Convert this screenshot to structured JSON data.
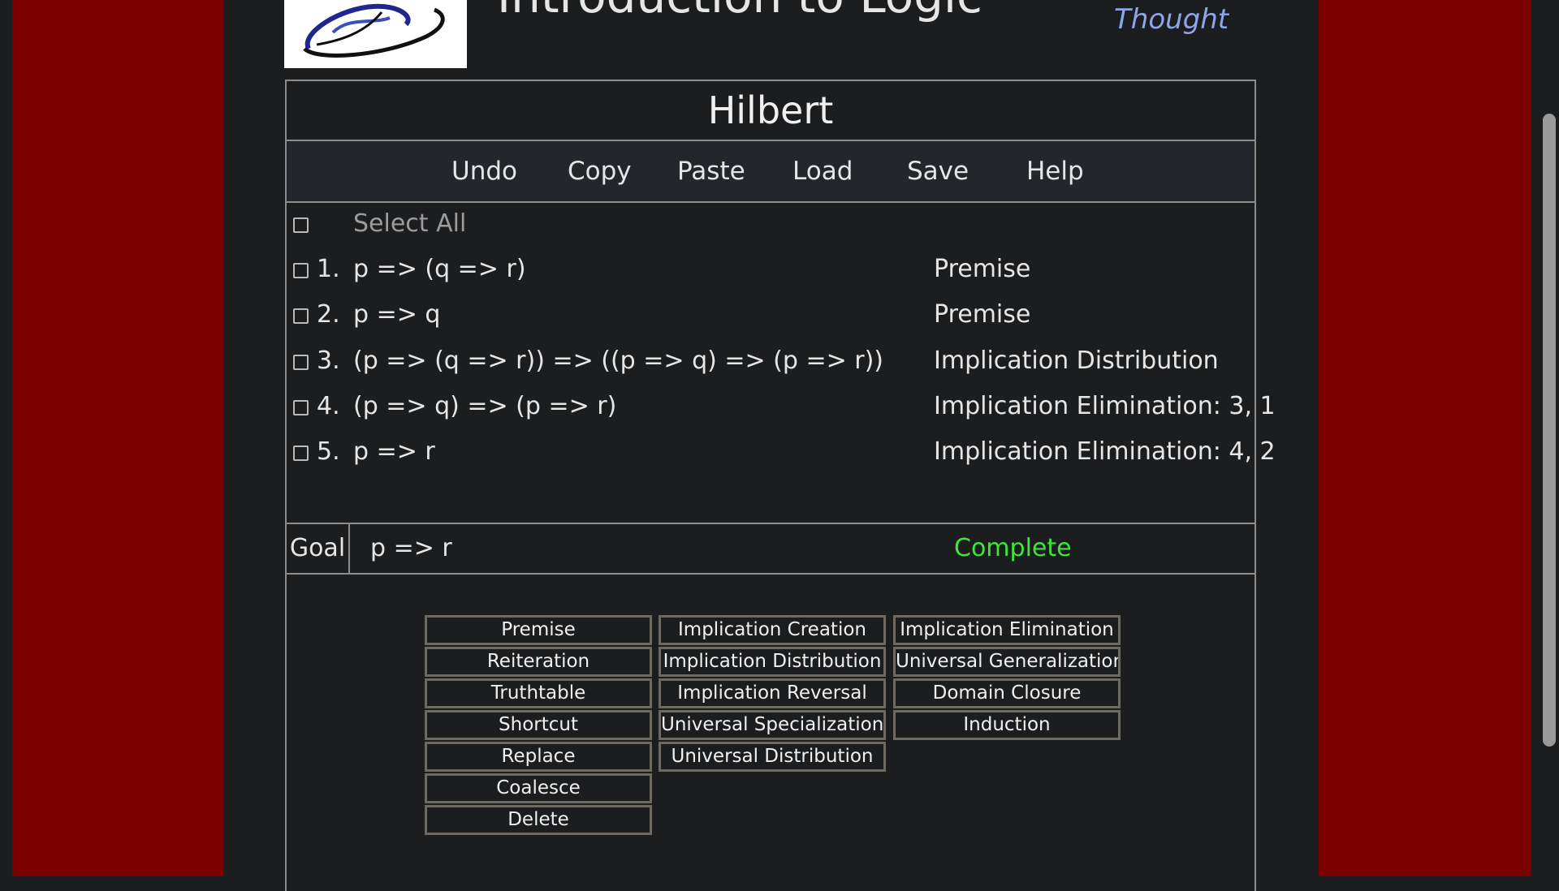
{
  "colors": {
    "background": "#1c1d1f",
    "side_band": "#7a0000",
    "status_complete": "#3ee53a",
    "tagline": "#8ea6e8"
  },
  "header": {
    "title": "Introduction to Logic",
    "tagline": "Thought",
    "logo_icon": "swirl-logo-icon"
  },
  "panel": {
    "title": "Hilbert"
  },
  "toolbar": [
    "Undo",
    "Copy",
    "Paste",
    "Load",
    "Save",
    "Help"
  ],
  "proof": {
    "select_all_label": "Select All",
    "rows": [
      {
        "num": "1.",
        "formula": "p => (q => r)",
        "justification": "Premise"
      },
      {
        "num": "2.",
        "formula": "p => q",
        "justification": "Premise"
      },
      {
        "num": "3.",
        "formula": "(p => (q => r)) => ((p => q) => (p => r))",
        "justification": "Implication Distribution"
      },
      {
        "num": "4.",
        "formula": "(p => q) => (p => r)",
        "justification": "Implication Elimination: 3, 1"
      },
      {
        "num": "5.",
        "formula": "p => r",
        "justification": "Implication Elimination: 4, 2"
      }
    ]
  },
  "goal": {
    "label": "Goal",
    "formula": "p => r",
    "status": "Complete"
  },
  "rules": {
    "col1": [
      "Premise",
      "Reiteration",
      "Truthtable",
      "Shortcut",
      "Replace",
      "Coalesce",
      "Delete"
    ],
    "col2": [
      "Implication Creation",
      "Implication Distribution",
      "Implication Reversal",
      "Universal Specialization",
      "Universal Distribution"
    ],
    "col3": [
      "Implication Elimination",
      "Universal Generalization",
      "Domain Closure",
      "Induction"
    ]
  }
}
